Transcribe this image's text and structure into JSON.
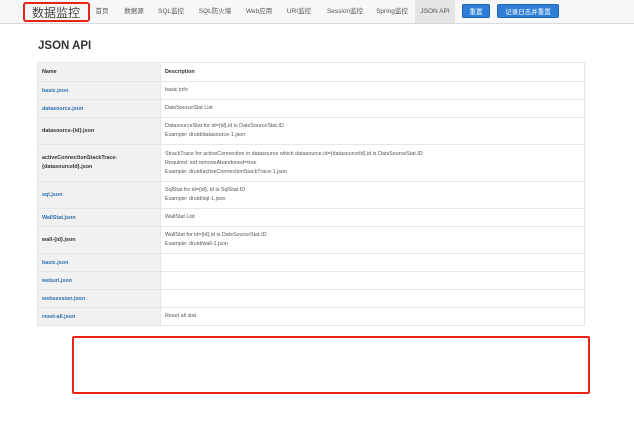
{
  "header": {
    "brand": "数据监控",
    "nav": [
      "首页",
      "数据源",
      "SQL监控",
      "SQL防火墙",
      "Web应用",
      "URI监控",
      "Session监控",
      "Spring监控",
      "JSON API"
    ],
    "reset_button": "重置",
    "log_reset_button": "记录日志并重置"
  },
  "main": {
    "title": "JSON API",
    "table": {
      "headers": [
        "Name",
        "Description"
      ],
      "rows": [
        {
          "name": "basic.json",
          "desc": [
            "basic info"
          ]
        },
        {
          "name": "datasource.json",
          "desc": [
            "DatsSourceStat List"
          ]
        },
        {
          "name": "datasource-{id}.json",
          "desc": [
            "DatasourceStat for id={id},id is DatsSourceStat.ID",
            "Example: druid/datasource-1.json"
          ]
        },
        {
          "name": "activeConnectionStackTrace-{datasourceId}.json",
          "desc": [
            "StrackTrace for activeConnection in datasource which datasource.id={datasourceId},id is DatsSourceStat.ID",
            "Required: set removeAbandoned=true",
            "Example: druid/activeConnectionStackTrace-1.json"
          ]
        },
        {
          "name": "sql.json",
          "desc": [
            "SqlStat for id={id}, id is SqlStat.ID",
            "Example: druid/sql-1.json"
          ]
        },
        {
          "name": "WallStat.json",
          "desc": [
            "WallStat List"
          ]
        },
        {
          "name": "wall-{id}.json",
          "desc": [
            "WallStat for id={id},id is DatsSourceStat.ID",
            "Example: druid/wall-1.json"
          ]
        },
        {
          "name": "basic.json",
          "desc": []
        },
        {
          "name": "weburi.json",
          "desc": []
        },
        {
          "name": "websession.json",
          "desc": []
        },
        {
          "name": "reset-all.json",
          "desc": [
            "Reset all stat"
          ]
        }
      ]
    }
  }
}
